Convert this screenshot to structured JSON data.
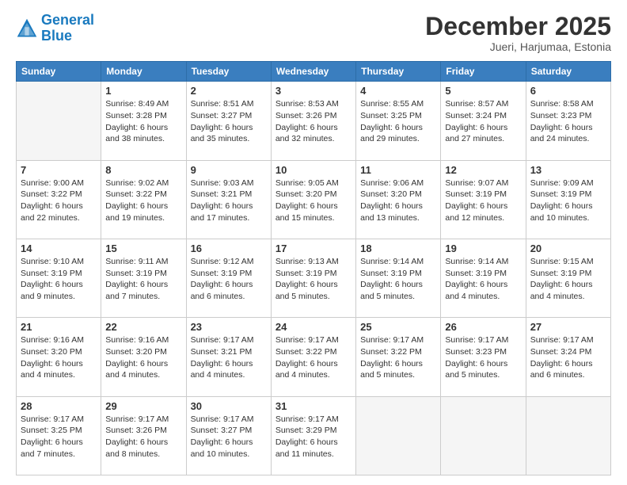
{
  "header": {
    "logo_line1": "General",
    "logo_line2": "Blue",
    "month": "December 2025",
    "location": "Jueri, Harjumaa, Estonia"
  },
  "weekdays": [
    "Sunday",
    "Monday",
    "Tuesday",
    "Wednesday",
    "Thursday",
    "Friday",
    "Saturday"
  ],
  "weeks": [
    [
      {
        "day": "",
        "info": ""
      },
      {
        "day": "1",
        "info": "Sunrise: 8:49 AM\nSunset: 3:28 PM\nDaylight: 6 hours\nand 38 minutes."
      },
      {
        "day": "2",
        "info": "Sunrise: 8:51 AM\nSunset: 3:27 PM\nDaylight: 6 hours\nand 35 minutes."
      },
      {
        "day": "3",
        "info": "Sunrise: 8:53 AM\nSunset: 3:26 PM\nDaylight: 6 hours\nand 32 minutes."
      },
      {
        "day": "4",
        "info": "Sunrise: 8:55 AM\nSunset: 3:25 PM\nDaylight: 6 hours\nand 29 minutes."
      },
      {
        "day": "5",
        "info": "Sunrise: 8:57 AM\nSunset: 3:24 PM\nDaylight: 6 hours\nand 27 minutes."
      },
      {
        "day": "6",
        "info": "Sunrise: 8:58 AM\nSunset: 3:23 PM\nDaylight: 6 hours\nand 24 minutes."
      }
    ],
    [
      {
        "day": "7",
        "info": "Sunrise: 9:00 AM\nSunset: 3:22 PM\nDaylight: 6 hours\nand 22 minutes."
      },
      {
        "day": "8",
        "info": "Sunrise: 9:02 AM\nSunset: 3:22 PM\nDaylight: 6 hours\nand 19 minutes."
      },
      {
        "day": "9",
        "info": "Sunrise: 9:03 AM\nSunset: 3:21 PM\nDaylight: 6 hours\nand 17 minutes."
      },
      {
        "day": "10",
        "info": "Sunrise: 9:05 AM\nSunset: 3:20 PM\nDaylight: 6 hours\nand 15 minutes."
      },
      {
        "day": "11",
        "info": "Sunrise: 9:06 AM\nSunset: 3:20 PM\nDaylight: 6 hours\nand 13 minutes."
      },
      {
        "day": "12",
        "info": "Sunrise: 9:07 AM\nSunset: 3:19 PM\nDaylight: 6 hours\nand 12 minutes."
      },
      {
        "day": "13",
        "info": "Sunrise: 9:09 AM\nSunset: 3:19 PM\nDaylight: 6 hours\nand 10 minutes."
      }
    ],
    [
      {
        "day": "14",
        "info": "Sunrise: 9:10 AM\nSunset: 3:19 PM\nDaylight: 6 hours\nand 9 minutes."
      },
      {
        "day": "15",
        "info": "Sunrise: 9:11 AM\nSunset: 3:19 PM\nDaylight: 6 hours\nand 7 minutes."
      },
      {
        "day": "16",
        "info": "Sunrise: 9:12 AM\nSunset: 3:19 PM\nDaylight: 6 hours\nand 6 minutes."
      },
      {
        "day": "17",
        "info": "Sunrise: 9:13 AM\nSunset: 3:19 PM\nDaylight: 6 hours\nand 5 minutes."
      },
      {
        "day": "18",
        "info": "Sunrise: 9:14 AM\nSunset: 3:19 PM\nDaylight: 6 hours\nand 5 minutes."
      },
      {
        "day": "19",
        "info": "Sunrise: 9:14 AM\nSunset: 3:19 PM\nDaylight: 6 hours\nand 4 minutes."
      },
      {
        "day": "20",
        "info": "Sunrise: 9:15 AM\nSunset: 3:19 PM\nDaylight: 6 hours\nand 4 minutes."
      }
    ],
    [
      {
        "day": "21",
        "info": "Sunrise: 9:16 AM\nSunset: 3:20 PM\nDaylight: 6 hours\nand 4 minutes."
      },
      {
        "day": "22",
        "info": "Sunrise: 9:16 AM\nSunset: 3:20 PM\nDaylight: 6 hours\nand 4 minutes."
      },
      {
        "day": "23",
        "info": "Sunrise: 9:17 AM\nSunset: 3:21 PM\nDaylight: 6 hours\nand 4 minutes."
      },
      {
        "day": "24",
        "info": "Sunrise: 9:17 AM\nSunset: 3:22 PM\nDaylight: 6 hours\nand 4 minutes."
      },
      {
        "day": "25",
        "info": "Sunrise: 9:17 AM\nSunset: 3:22 PM\nDaylight: 6 hours\nand 5 minutes."
      },
      {
        "day": "26",
        "info": "Sunrise: 9:17 AM\nSunset: 3:23 PM\nDaylight: 6 hours\nand 5 minutes."
      },
      {
        "day": "27",
        "info": "Sunrise: 9:17 AM\nSunset: 3:24 PM\nDaylight: 6 hours\nand 6 minutes."
      }
    ],
    [
      {
        "day": "28",
        "info": "Sunrise: 9:17 AM\nSunset: 3:25 PM\nDaylight: 6 hours\nand 7 minutes."
      },
      {
        "day": "29",
        "info": "Sunrise: 9:17 AM\nSunset: 3:26 PM\nDaylight: 6 hours\nand 8 minutes."
      },
      {
        "day": "30",
        "info": "Sunrise: 9:17 AM\nSunset: 3:27 PM\nDaylight: 6 hours\nand 10 minutes."
      },
      {
        "day": "31",
        "info": "Sunrise: 9:17 AM\nSunset: 3:29 PM\nDaylight: 6 hours\nand 11 minutes."
      },
      {
        "day": "",
        "info": ""
      },
      {
        "day": "",
        "info": ""
      },
      {
        "day": "",
        "info": ""
      }
    ]
  ]
}
